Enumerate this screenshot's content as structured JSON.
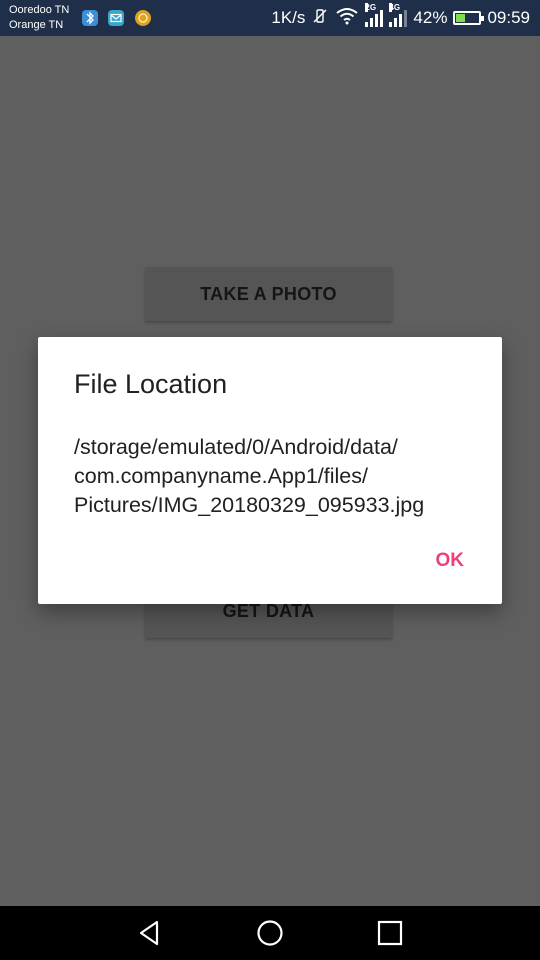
{
  "status_bar": {
    "carrier_1": "Ooredoo TN",
    "carrier_2": "Orange TN",
    "notification_icons": [
      "bluetooth-app-icon",
      "mail-icon",
      "coin-icon"
    ],
    "net_speed": "1K/s",
    "signal_1_tag": "2G",
    "signal_2_tag": "4G",
    "battery_percent_text": "42%",
    "battery_level": 0.42,
    "time": "09:59",
    "colors": {
      "background": "#1f2f4a",
      "battery_fill": "#7ee04a"
    }
  },
  "app": {
    "take_photo_label": "TAKE A PHOTO",
    "get_data_label": "GET DATA",
    "background": "#5f5f5f"
  },
  "dialog": {
    "title": "File Location",
    "message": "/storage/emulated/0/Android/data/\ncom.companyname.App1/files/\nPictures/IMG_20180329_095933.jpg",
    "ok_label": "OK",
    "accent": "#ec407a"
  },
  "nav_bar": {
    "buttons": [
      "back-icon",
      "home-icon",
      "recents-icon"
    ]
  }
}
